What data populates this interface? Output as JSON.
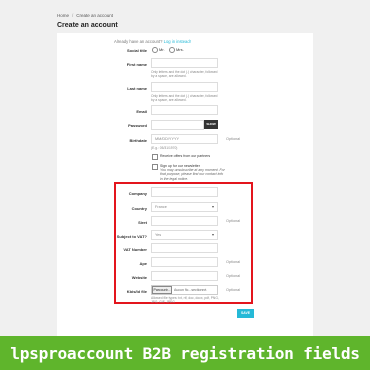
{
  "breadcrumb": {
    "home": "Home",
    "sep": "/",
    "current": "Create an account"
  },
  "page_title": "Create an account",
  "already": {
    "text": "Already have an account?",
    "link": "Log in instead!"
  },
  "social_title": {
    "label": "Social title",
    "options": [
      "Mr.",
      "Mrs."
    ]
  },
  "first_name": {
    "label": "First name",
    "help": "Only letters and the dot (.) character, followed by a space, are allowed."
  },
  "last_name": {
    "label": "Last name",
    "help": "Only letters and the dot (.) character, followed by a space, are allowed."
  },
  "email": {
    "label": "Email"
  },
  "password": {
    "label": "Password",
    "show": "SHOW"
  },
  "birthdate": {
    "label": "Birthdate",
    "placeholder": "MM/DD/YYYY",
    "help": "(E.g.: 05/31/1970)",
    "optional": "Optional"
  },
  "offers": {
    "text": "Receive offers from our partners"
  },
  "newsletter": {
    "text": "Sign up for our newsletter",
    "note": "You may unsubscribe at any moment. For that purpose, please find our contact info in the legal notice."
  },
  "b2b": {
    "company": {
      "label": "Company"
    },
    "country": {
      "label": "Country",
      "value": "France"
    },
    "siret": {
      "label": "Siret",
      "optional": "Optional"
    },
    "vat_subject": {
      "label": "Subject to VAT?",
      "value": "Yes"
    },
    "vat_number": {
      "label": "VAT Number"
    },
    "ape": {
      "label": "Ape",
      "optional": "Optional"
    },
    "website": {
      "label": "Website",
      "optional": "Optional"
    },
    "kbis": {
      "label": "Kbis/Id file",
      "button": "Parcourir...",
      "filename": "Aucun fic...sectionné.",
      "optional": "Optional",
      "help": "Allowed file types: txt, rtf, doc, docx, pdf, PNG, JPG, GIF, JPEG"
    }
  },
  "save": "SAVE",
  "banner": "lpsproaccount B2B registration fields",
  "colors": {
    "accent": "#25b9d7",
    "highlight": "#e3151d",
    "banner": "#5fb52c"
  }
}
